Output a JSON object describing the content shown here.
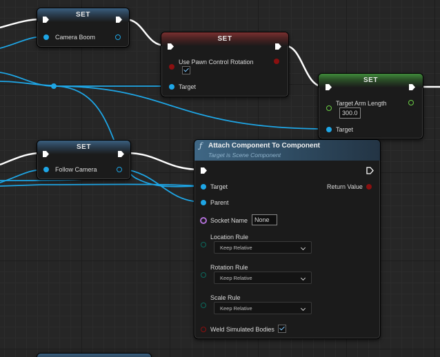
{
  "nodes": {
    "set_camera_boom": {
      "title": "SET",
      "pin_label": "Camera Boom"
    },
    "set_use_pawn": {
      "title": "SET",
      "pin_label": "Use Pawn Control Rotation",
      "checked": true,
      "target_label": "Target"
    },
    "set_arm_length": {
      "title": "SET",
      "pin_label": "Target Arm Length",
      "value": "300.0",
      "target_label": "Target"
    },
    "set_follow_camera": {
      "title": "SET",
      "pin_label": "Follow Camera"
    },
    "attach": {
      "title": "Attach Component To Component",
      "subtitle": "Target is Scene Component",
      "target_label": "Target",
      "parent_label": "Parent",
      "return_label": "Return Value",
      "socket_label": "Socket Name",
      "socket_value": "None",
      "location_label": "Location Rule",
      "location_value": "Keep Relative",
      "rotation_label": "Rotation Rule",
      "rotation_value": "Keep Relative",
      "scale_label": "Scale Rule",
      "scale_value": "Keep Relative",
      "weld_label": "Weld Simulated Bodies",
      "weld_checked": true
    }
  },
  "colors": {
    "background": "#262626",
    "object_pin": "#1ea6e6",
    "exec_wire": "#ffffff",
    "float_pin": "#6cd045",
    "bool_pin": "#8a1010",
    "name_pin": "#b06fd6",
    "byte_pin": "#0c6a5e"
  }
}
